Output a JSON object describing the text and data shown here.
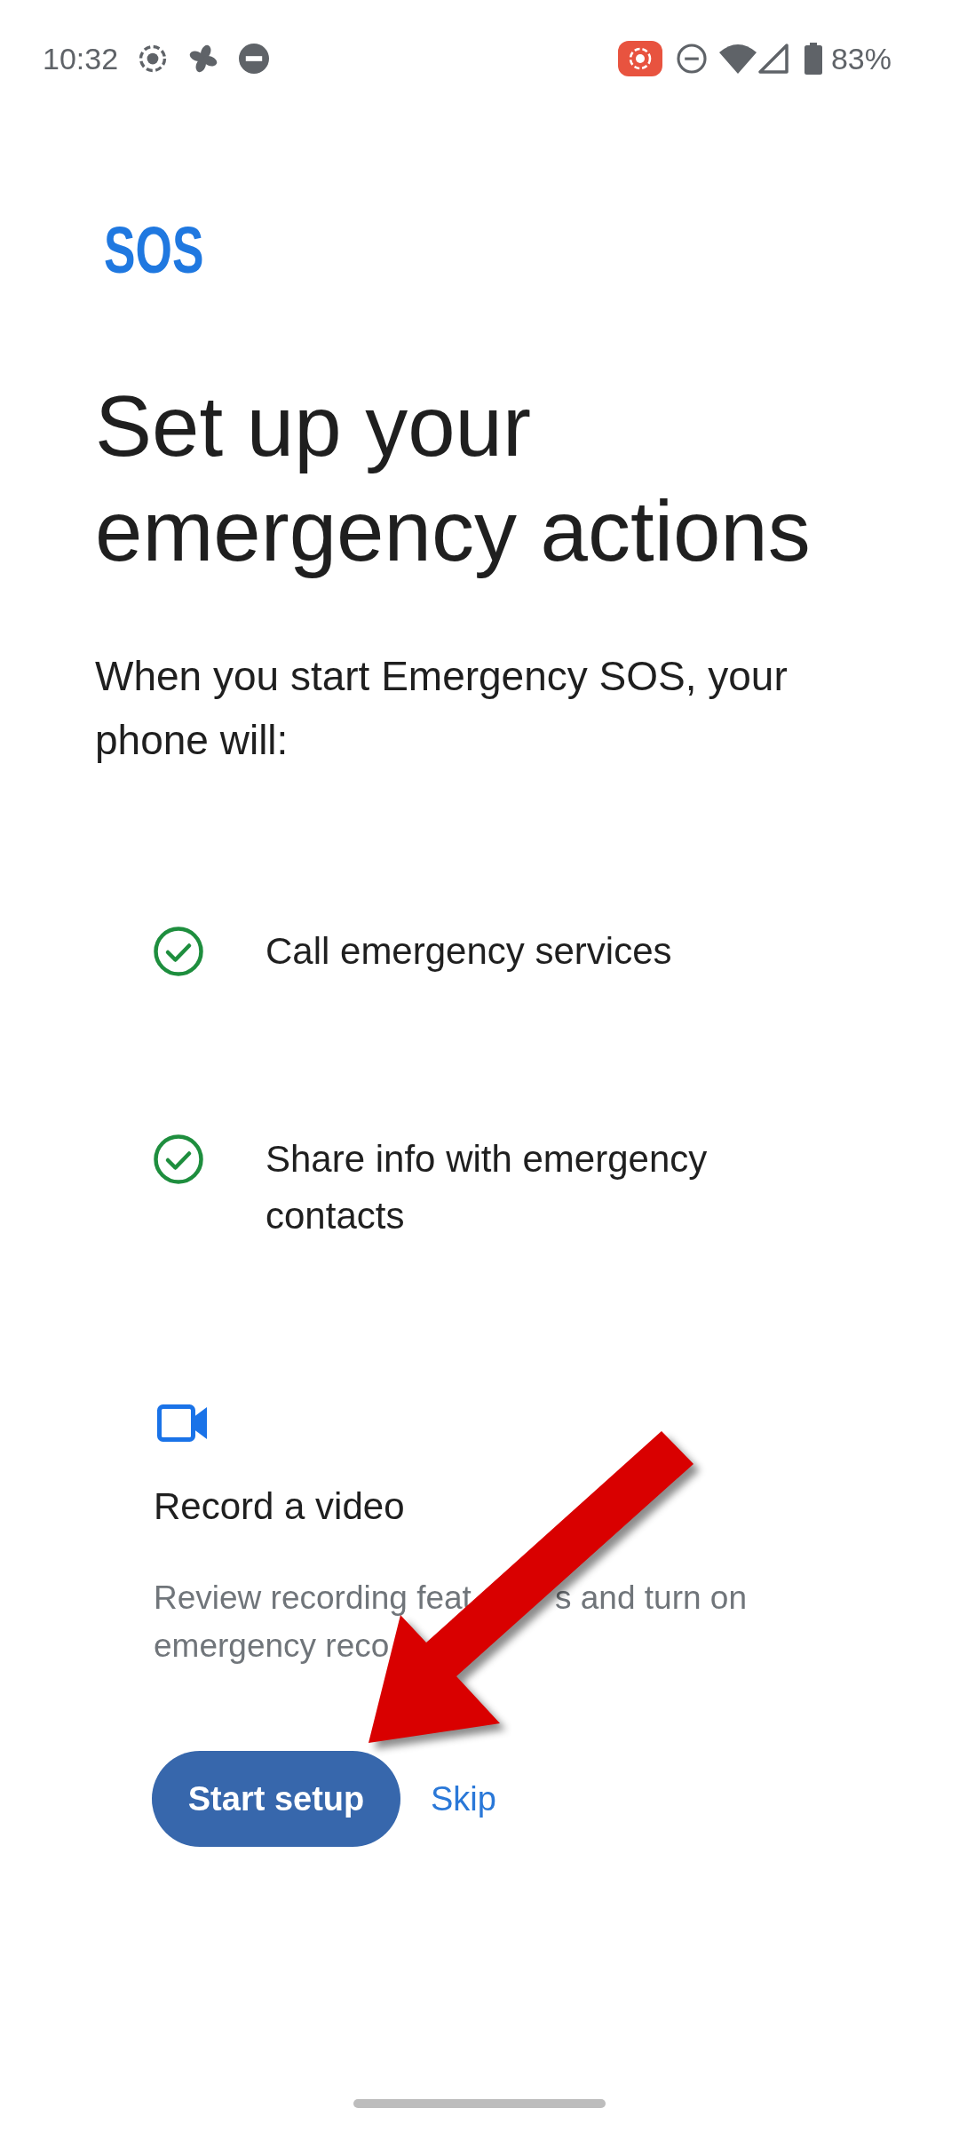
{
  "status_bar": {
    "time": "10:32",
    "battery_percent": "83%"
  },
  "logo": "SOS",
  "title": "Set up your emergency actions",
  "intro": "When you start Emergency SOS, your phone will:",
  "actions": [
    {
      "kind": "check",
      "label": "Call emergency services"
    },
    {
      "kind": "check",
      "label": "Share info with emergency contacts"
    },
    {
      "kind": "video",
      "label": "Record a video",
      "description_lines": [
        [
          "Review recording feat",
          "s and turn on"
        ],
        [
          "emergency reco"
        ]
      ]
    }
  ],
  "buttons": {
    "primary": "Start setup",
    "secondary": "Skip"
  }
}
